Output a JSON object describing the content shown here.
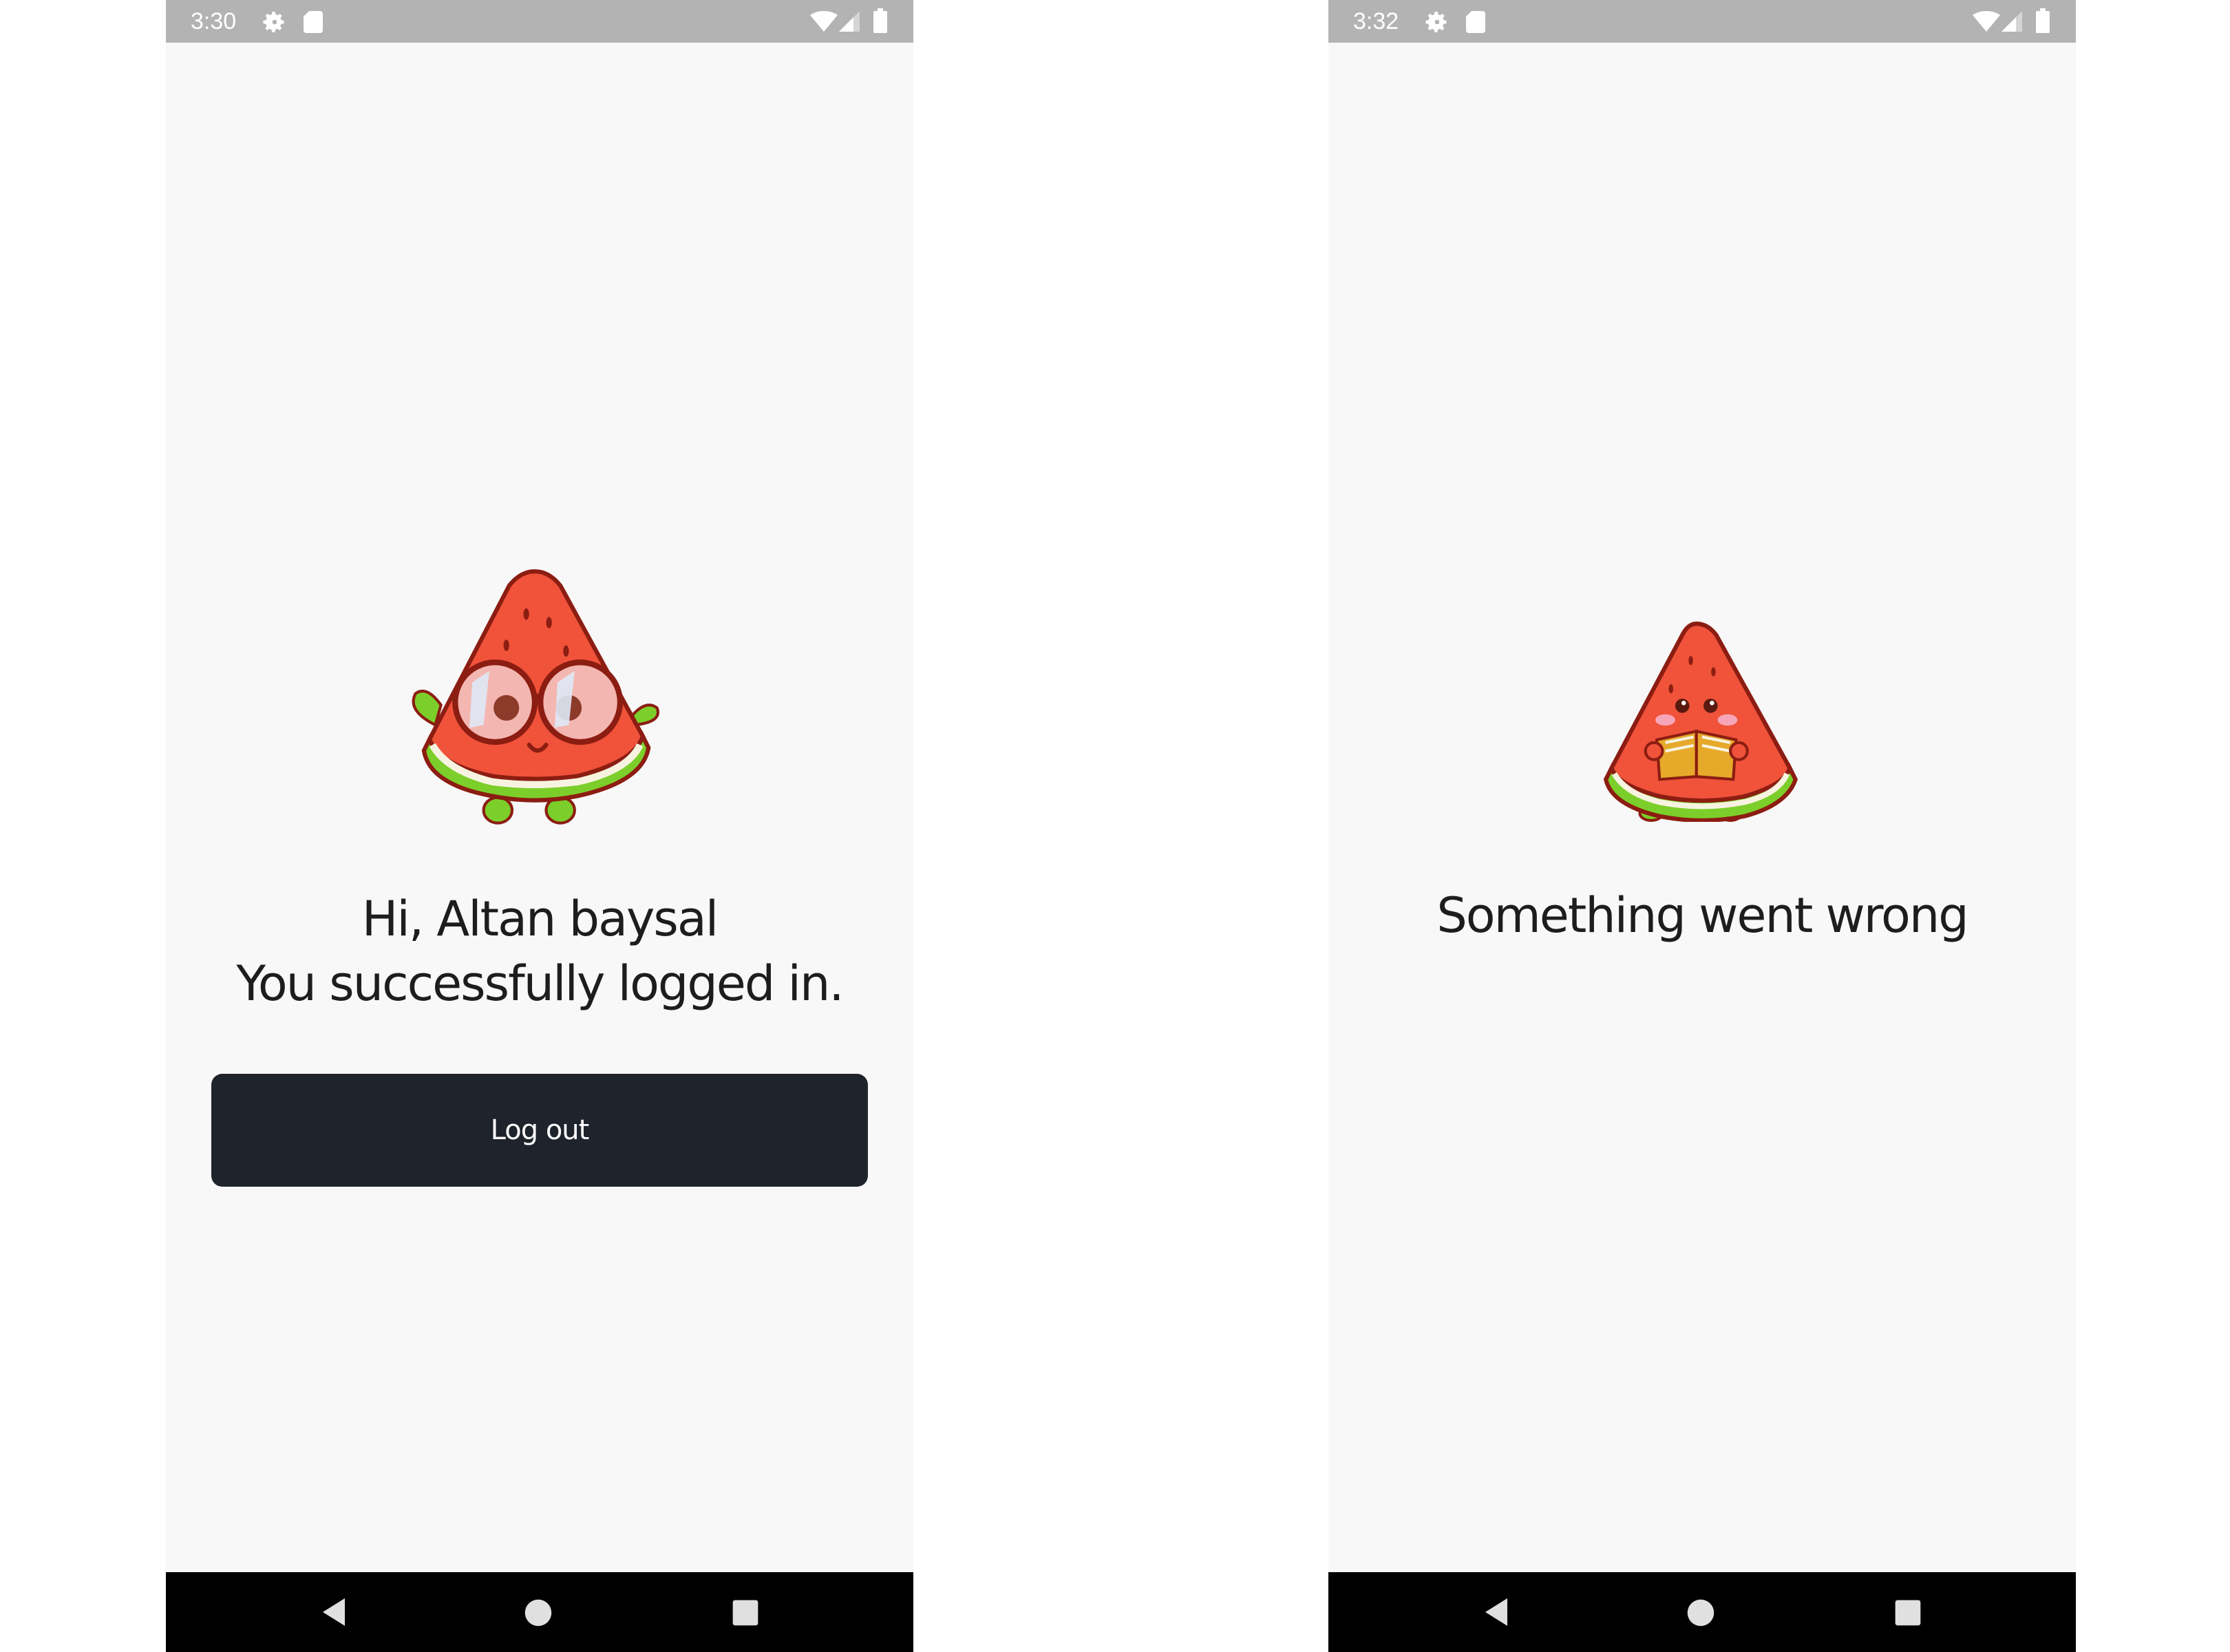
{
  "screens": [
    {
      "status_bar": {
        "time": "3:30",
        "icons": [
          "settings-gear-icon",
          "sd-card-icon",
          "wifi-icon",
          "cell-signal-icon",
          "battery-icon"
        ]
      },
      "illustration": "watermelon-with-glasses-illustration",
      "message": {
        "line1": "Hi, Altan baysal",
        "line2": "You successfully logged in."
      },
      "button": {
        "label": "Log out",
        "color": "#1f232b"
      },
      "nav_bar": [
        "back-icon",
        "home-icon",
        "recents-icon"
      ]
    },
    {
      "status_bar": {
        "time": "3:32",
        "icons": [
          "settings-gear-icon",
          "sd-card-icon",
          "wifi-icon",
          "cell-signal-icon",
          "battery-icon"
        ]
      },
      "illustration": "watermelon-reading-book-illustration",
      "message": {
        "line1": "Something went wrong"
      },
      "nav_bar": [
        "back-icon",
        "home-icon",
        "recents-icon"
      ]
    }
  ],
  "colors": {
    "status_bar": "#b3b3b3",
    "screen_background": "#f8f8f8",
    "nav_bar": "#000000",
    "text": "#1d1d1d",
    "watermelon_flesh": "#f0533a",
    "watermelon_rind": "#7ccf2a",
    "outline": "#8c1d12"
  }
}
